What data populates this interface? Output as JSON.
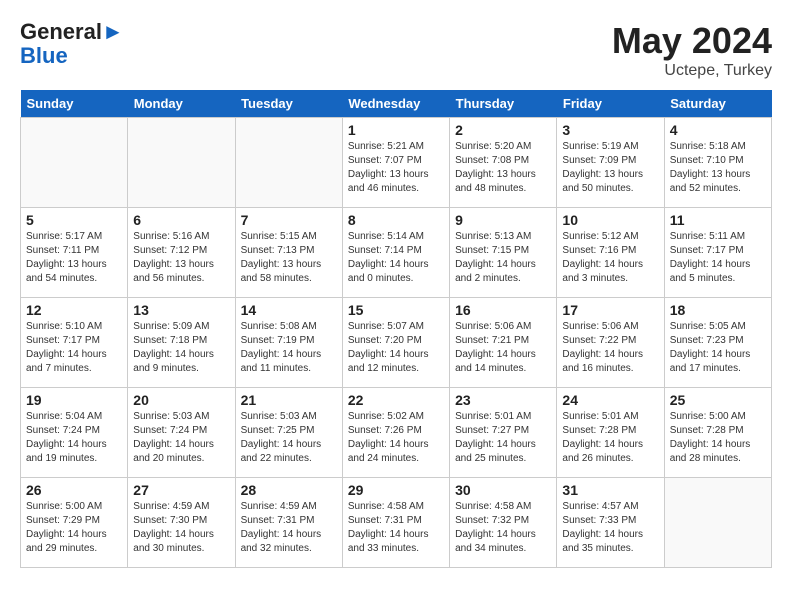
{
  "logo": {
    "line1": "General",
    "line2": "Blue"
  },
  "title": "May 2024",
  "location": "Uctepe, Turkey",
  "weekdays": [
    "Sunday",
    "Monday",
    "Tuesday",
    "Wednesday",
    "Thursday",
    "Friday",
    "Saturday"
  ],
  "weeks": [
    [
      {
        "day": "",
        "info": ""
      },
      {
        "day": "",
        "info": ""
      },
      {
        "day": "",
        "info": ""
      },
      {
        "day": "1",
        "info": "Sunrise: 5:21 AM\nSunset: 7:07 PM\nDaylight: 13 hours\nand 46 minutes."
      },
      {
        "day": "2",
        "info": "Sunrise: 5:20 AM\nSunset: 7:08 PM\nDaylight: 13 hours\nand 48 minutes."
      },
      {
        "day": "3",
        "info": "Sunrise: 5:19 AM\nSunset: 7:09 PM\nDaylight: 13 hours\nand 50 minutes."
      },
      {
        "day": "4",
        "info": "Sunrise: 5:18 AM\nSunset: 7:10 PM\nDaylight: 13 hours\nand 52 minutes."
      }
    ],
    [
      {
        "day": "5",
        "info": "Sunrise: 5:17 AM\nSunset: 7:11 PM\nDaylight: 13 hours\nand 54 minutes."
      },
      {
        "day": "6",
        "info": "Sunrise: 5:16 AM\nSunset: 7:12 PM\nDaylight: 13 hours\nand 56 minutes."
      },
      {
        "day": "7",
        "info": "Sunrise: 5:15 AM\nSunset: 7:13 PM\nDaylight: 13 hours\nand 58 minutes."
      },
      {
        "day": "8",
        "info": "Sunrise: 5:14 AM\nSunset: 7:14 PM\nDaylight: 14 hours\nand 0 minutes."
      },
      {
        "day": "9",
        "info": "Sunrise: 5:13 AM\nSunset: 7:15 PM\nDaylight: 14 hours\nand 2 minutes."
      },
      {
        "day": "10",
        "info": "Sunrise: 5:12 AM\nSunset: 7:16 PM\nDaylight: 14 hours\nand 3 minutes."
      },
      {
        "day": "11",
        "info": "Sunrise: 5:11 AM\nSunset: 7:17 PM\nDaylight: 14 hours\nand 5 minutes."
      }
    ],
    [
      {
        "day": "12",
        "info": "Sunrise: 5:10 AM\nSunset: 7:17 PM\nDaylight: 14 hours\nand 7 minutes."
      },
      {
        "day": "13",
        "info": "Sunrise: 5:09 AM\nSunset: 7:18 PM\nDaylight: 14 hours\nand 9 minutes."
      },
      {
        "day": "14",
        "info": "Sunrise: 5:08 AM\nSunset: 7:19 PM\nDaylight: 14 hours\nand 11 minutes."
      },
      {
        "day": "15",
        "info": "Sunrise: 5:07 AM\nSunset: 7:20 PM\nDaylight: 14 hours\nand 12 minutes."
      },
      {
        "day": "16",
        "info": "Sunrise: 5:06 AM\nSunset: 7:21 PM\nDaylight: 14 hours\nand 14 minutes."
      },
      {
        "day": "17",
        "info": "Sunrise: 5:06 AM\nSunset: 7:22 PM\nDaylight: 14 hours\nand 16 minutes."
      },
      {
        "day": "18",
        "info": "Sunrise: 5:05 AM\nSunset: 7:23 PM\nDaylight: 14 hours\nand 17 minutes."
      }
    ],
    [
      {
        "day": "19",
        "info": "Sunrise: 5:04 AM\nSunset: 7:24 PM\nDaylight: 14 hours\nand 19 minutes."
      },
      {
        "day": "20",
        "info": "Sunrise: 5:03 AM\nSunset: 7:24 PM\nDaylight: 14 hours\nand 20 minutes."
      },
      {
        "day": "21",
        "info": "Sunrise: 5:03 AM\nSunset: 7:25 PM\nDaylight: 14 hours\nand 22 minutes."
      },
      {
        "day": "22",
        "info": "Sunrise: 5:02 AM\nSunset: 7:26 PM\nDaylight: 14 hours\nand 24 minutes."
      },
      {
        "day": "23",
        "info": "Sunrise: 5:01 AM\nSunset: 7:27 PM\nDaylight: 14 hours\nand 25 minutes."
      },
      {
        "day": "24",
        "info": "Sunrise: 5:01 AM\nSunset: 7:28 PM\nDaylight: 14 hours\nand 26 minutes."
      },
      {
        "day": "25",
        "info": "Sunrise: 5:00 AM\nSunset: 7:28 PM\nDaylight: 14 hours\nand 28 minutes."
      }
    ],
    [
      {
        "day": "26",
        "info": "Sunrise: 5:00 AM\nSunset: 7:29 PM\nDaylight: 14 hours\nand 29 minutes."
      },
      {
        "day": "27",
        "info": "Sunrise: 4:59 AM\nSunset: 7:30 PM\nDaylight: 14 hours\nand 30 minutes."
      },
      {
        "day": "28",
        "info": "Sunrise: 4:59 AM\nSunset: 7:31 PM\nDaylight: 14 hours\nand 32 minutes."
      },
      {
        "day": "29",
        "info": "Sunrise: 4:58 AM\nSunset: 7:31 PM\nDaylight: 14 hours\nand 33 minutes."
      },
      {
        "day": "30",
        "info": "Sunrise: 4:58 AM\nSunset: 7:32 PM\nDaylight: 14 hours\nand 34 minutes."
      },
      {
        "day": "31",
        "info": "Sunrise: 4:57 AM\nSunset: 7:33 PM\nDaylight: 14 hours\nand 35 minutes."
      },
      {
        "day": "",
        "info": ""
      }
    ]
  ]
}
